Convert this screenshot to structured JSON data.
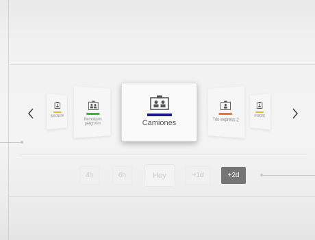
{
  "nav": {
    "prev_icon": "chevron-left-icon",
    "next_icon": "chevron-right-icon"
  },
  "carousel": {
    "items": [
      {
        "label": "BALONERA",
        "icon": "id-card-icon",
        "color": "#f0b429",
        "position": "far-left"
      },
      {
        "label": "Remolques peligrosos",
        "icon": "id-card-group-icon",
        "color": "#2eb82e",
        "position": "near-left"
      },
      {
        "label": "Camiones",
        "icon": "id-card-group-icon",
        "color": "#1a1a8c",
        "position": "center",
        "selected": true
      },
      {
        "label": "Tdo express 2",
        "icon": "id-card-icon",
        "color": "#e8722a",
        "position": "near-right"
      },
      {
        "label": "AFIMORE",
        "icon": "id-card-icon",
        "color": "#f0b429",
        "position": "far-right"
      }
    ]
  },
  "time_range": {
    "options": [
      {
        "label": "4h",
        "selected": false
      },
      {
        "label": "6h",
        "selected": false
      },
      {
        "label": "Hoy",
        "selected": false
      },
      {
        "label": "+1d",
        "selected": false
      },
      {
        "label": "+2d",
        "selected": true
      }
    ]
  },
  "colors": {
    "selected_button": "#757575",
    "unselected_text": "#c9c9c9",
    "card_background": "#f6f6f6"
  }
}
